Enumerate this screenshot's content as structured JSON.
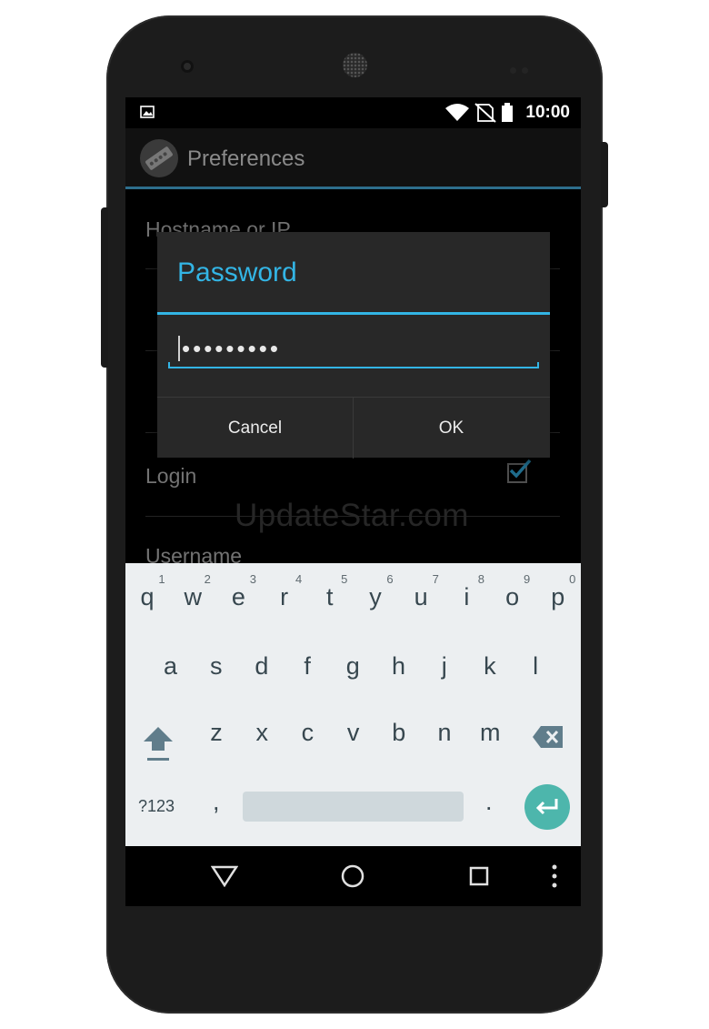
{
  "statusbar": {
    "time": "10:00",
    "icons": [
      "image-icon",
      "wifi-icon",
      "no-sim-icon",
      "battery-icon"
    ]
  },
  "actionbar": {
    "title": "Preferences",
    "icon": "remote-control-icon"
  },
  "preferences": {
    "hostname_label": "Hostname or IP",
    "login_label": "Login",
    "login_checked": true,
    "username_label": "Username"
  },
  "watermark": "UpdateStar.com",
  "dialog": {
    "title": "Password",
    "password_value": "•••••••••",
    "cancel_label": "Cancel",
    "ok_label": "OK"
  },
  "keyboard": {
    "row1": [
      "q",
      "w",
      "e",
      "r",
      "t",
      "y",
      "u",
      "i",
      "o",
      "p"
    ],
    "row1_hints": [
      "1",
      "2",
      "3",
      "4",
      "5",
      "6",
      "7",
      "8",
      "9",
      "0"
    ],
    "row2": [
      "a",
      "s",
      "d",
      "f",
      "g",
      "h",
      "j",
      "k",
      "l"
    ],
    "row3": [
      "z",
      "x",
      "c",
      "v",
      "b",
      "n",
      "m"
    ],
    "symbols_label": "?123",
    "comma": ",",
    "period": "."
  },
  "colors": {
    "accent": "#33b5e5",
    "enter_key": "#4db6ac",
    "keyboard_bg": "#eceff1",
    "key_text": "#37474f"
  },
  "navbar": {
    "icons": [
      "back-icon",
      "home-icon",
      "recent-apps-icon",
      "overflow-menu-icon"
    ]
  }
}
